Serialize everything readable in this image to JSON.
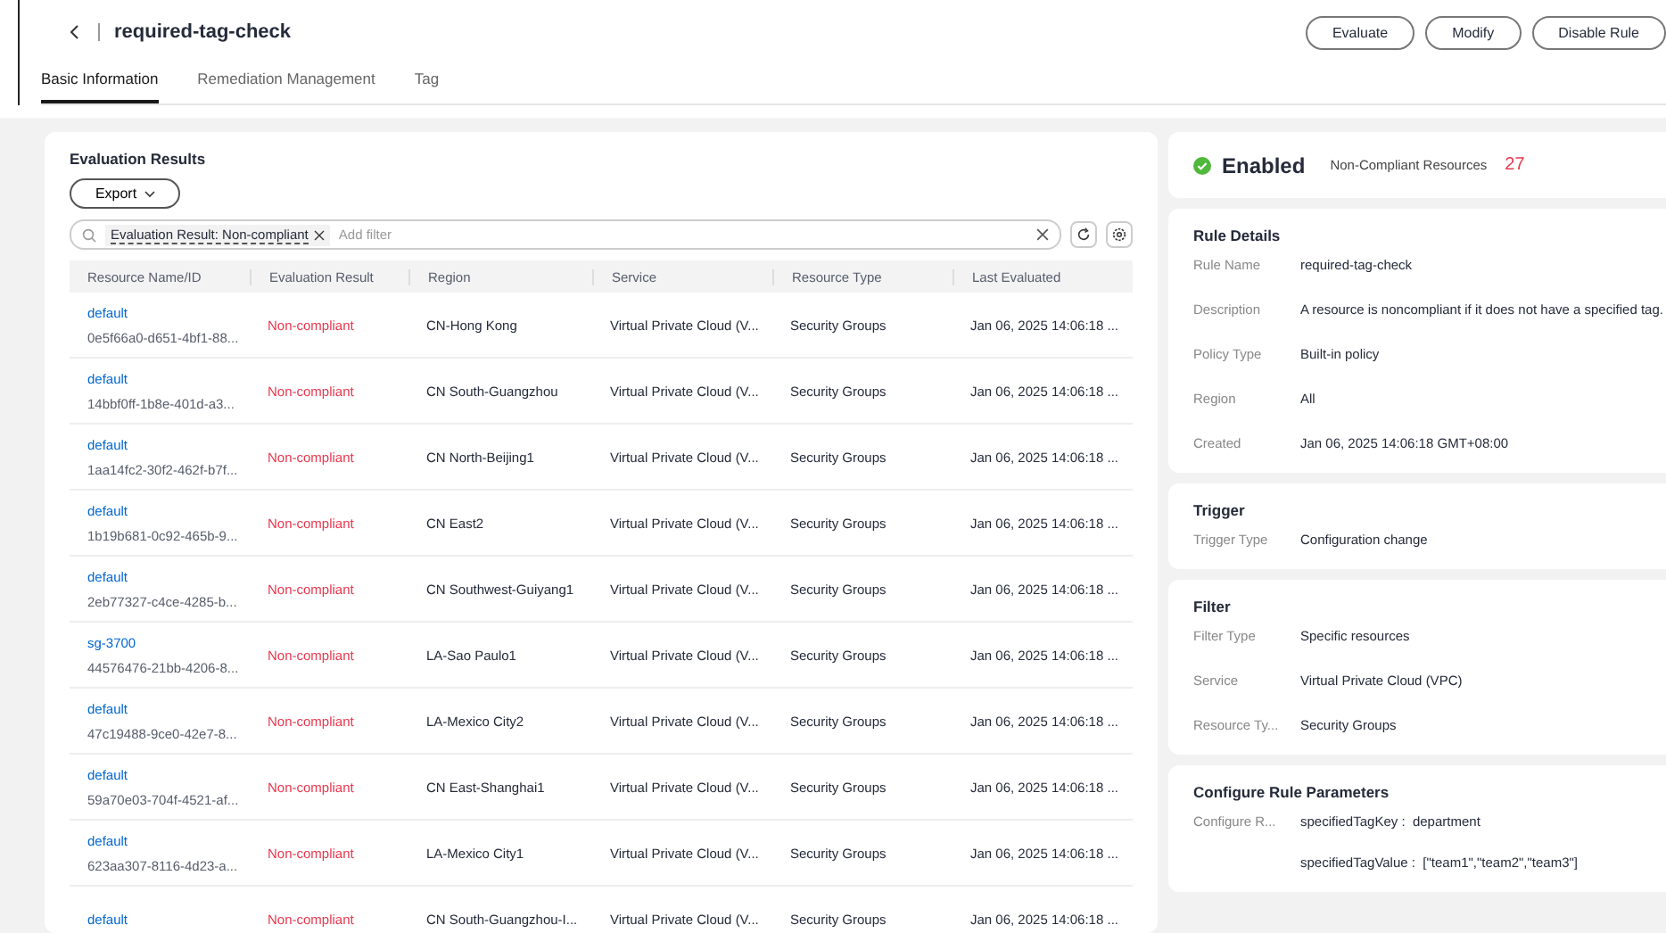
{
  "header": {
    "title": "required-tag-check",
    "buttons": [
      "Evaluate",
      "Modify",
      "Disable Rule"
    ]
  },
  "tabs": [
    {
      "label": "Basic Information",
      "selected": true
    },
    {
      "label": "Remediation Management",
      "selected": false
    },
    {
      "label": "Tag",
      "selected": false
    }
  ],
  "results": {
    "title": "Evaluation Results",
    "export": "Export",
    "filter": {
      "chip": "Evaluation Result: Non-compliant",
      "placeholder": "Add filter"
    },
    "columns": [
      "Resource Name/ID",
      "Evaluation Result",
      "Region",
      "Service",
      "Resource Type",
      "Last Evaluated"
    ],
    "rows": [
      {
        "name": "default",
        "id": "0e5f66a0-d651-4bf1-88...",
        "result": "Non-compliant",
        "region": "CN-Hong Kong",
        "service": "Virtual Private Cloud (V...",
        "type": "Security Groups",
        "evaluated": "Jan 06, 2025 14:06:18 ..."
      },
      {
        "name": "default",
        "id": "14bbf0ff-1b8e-401d-a3...",
        "result": "Non-compliant",
        "region": "CN South-Guangzhou",
        "service": "Virtual Private Cloud (V...",
        "type": "Security Groups",
        "evaluated": "Jan 06, 2025 14:06:18 ..."
      },
      {
        "name": "default",
        "id": "1aa14fc2-30f2-462f-b7f...",
        "result": "Non-compliant",
        "region": "CN North-Beijing1",
        "service": "Virtual Private Cloud (V...",
        "type": "Security Groups",
        "evaluated": "Jan 06, 2025 14:06:18 ..."
      },
      {
        "name": "default",
        "id": "1b19b681-0c92-465b-9...",
        "result": "Non-compliant",
        "region": "CN East2",
        "service": "Virtual Private Cloud (V...",
        "type": "Security Groups",
        "evaluated": "Jan 06, 2025 14:06:18 ..."
      },
      {
        "name": "default",
        "id": "2eb77327-c4ce-4285-b...",
        "result": "Non-compliant",
        "region": "CN Southwest-Guiyang1",
        "service": "Virtual Private Cloud (V...",
        "type": "Security Groups",
        "evaluated": "Jan 06, 2025 14:06:18 ..."
      },
      {
        "name": "sg-3700",
        "id": "44576476-21bb-4206-8...",
        "result": "Non-compliant",
        "region": "LA-Sao Paulo1",
        "service": "Virtual Private Cloud (V...",
        "type": "Security Groups",
        "evaluated": "Jan 06, 2025 14:06:18 ..."
      },
      {
        "name": "default",
        "id": "47c19488-9ce0-42e7-8...",
        "result": "Non-compliant",
        "region": "LA-Mexico City2",
        "service": "Virtual Private Cloud (V...",
        "type": "Security Groups",
        "evaluated": "Jan 06, 2025 14:06:18 ..."
      },
      {
        "name": "default",
        "id": "59a70e03-704f-4521-af...",
        "result": "Non-compliant",
        "region": "CN East-Shanghai1",
        "service": "Virtual Private Cloud (V...",
        "type": "Security Groups",
        "evaluated": "Jan 06, 2025 14:06:18 ..."
      },
      {
        "name": "default",
        "id": "623aa307-8116-4d23-a...",
        "result": "Non-compliant",
        "region": "LA-Mexico City1",
        "service": "Virtual Private Cloud (V...",
        "type": "Security Groups",
        "evaluated": "Jan 06, 2025 14:06:18 ..."
      },
      {
        "name": "default",
        "result": "Non-compliant",
        "region": "CN South-Guangzhou-I...",
        "service": "Virtual Private Cloud (V...",
        "type": "Security Groups",
        "evaluated": "Jan 06, 2025 14:06:18 ..."
      }
    ]
  },
  "status": {
    "state": "Enabled",
    "label": "Non-Compliant Resources",
    "count": "27"
  },
  "sections": [
    {
      "title": "Rule Details",
      "fields": [
        {
          "label": "Rule Name",
          "value": "required-tag-check"
        },
        {
          "label": "Description",
          "value": "A resource is noncompliant if it does not have a specified tag."
        },
        {
          "label": "Policy Type",
          "value": "Built-in policy"
        },
        {
          "label": "Region",
          "value": "All"
        },
        {
          "label": "Created",
          "value": "Jan 06, 2025 14:06:18 GMT+08:00"
        }
      ]
    },
    {
      "title": "Trigger",
      "fields": [
        {
          "label": "Trigger Type",
          "value": "Configuration change"
        }
      ]
    },
    {
      "title": "Filter",
      "fields": [
        {
          "label": "Filter Type",
          "value": "Specific resources"
        },
        {
          "label": "Service",
          "value": "Virtual Private Cloud (VPC)"
        },
        {
          "label": "Resource Ty...",
          "value": "Security Groups"
        }
      ]
    },
    {
      "title": "Configure Rule Parameters",
      "params": {
        "label": "Configure R...",
        "items": [
          {
            "key": "specifiedTagKey :",
            "value": "department"
          },
          {
            "key": "specifiedTagValue :",
            "value": "[\"team1\",\"team2\",\"team3\"]"
          }
        ]
      }
    }
  ]
}
